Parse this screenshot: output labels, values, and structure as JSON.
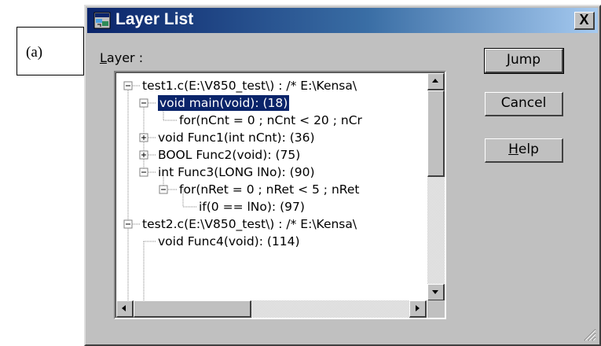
{
  "annotation": {
    "label": "(a)"
  },
  "dialog": {
    "title": "Layer List",
    "close_label": "X",
    "layer_label_prefix": "L",
    "layer_label_rest": "ayer :"
  },
  "tree": {
    "items": [
      {
        "label": "test1.c(E:\\V850_test\\) : /* E:\\Kensa\\",
        "expander": "minus"
      },
      {
        "label": "void main(void): (18)",
        "expander": "minus",
        "selected": true
      },
      {
        "label": "for(nCnt = 0 ; nCnt < 20 ; nCr",
        "expander": "none"
      },
      {
        "label": "void Func1(int nCnt): (36)",
        "expander": "plus"
      },
      {
        "label": "BOOL Func2(void): (75)",
        "expander": "plus"
      },
      {
        "label": "int Func3(LONG lNo): (90)",
        "expander": "minus"
      },
      {
        "label": "for(nRet = 0 ; nRet < 5 ; nRet",
        "expander": "minus"
      },
      {
        "label": "if(0 == lNo): (97)",
        "expander": "none"
      },
      {
        "label": "test2.c(E:\\V850_test\\) : /* E:\\Kensa\\",
        "expander": "minus"
      },
      {
        "label": "void Func4(void): (114)",
        "expander": "none"
      }
    ]
  },
  "buttons": {
    "jump": {
      "mnemonic": "J",
      "rest": "ump"
    },
    "cancel": {
      "label": "Cancel"
    },
    "help": {
      "mnemonic": "H",
      "rest": "elp"
    }
  },
  "icons": {
    "scroll_up": "scroll-up-arrow-icon",
    "scroll_down": "scroll-down-arrow-icon",
    "scroll_left": "scroll-left-arrow-icon",
    "scroll_right": "scroll-right-arrow-icon",
    "resize_grip": "resize-grip-icon"
  },
  "colors": {
    "selection": "#0a246a",
    "title_start": "#0a246a",
    "title_end": "#a6caf0",
    "face": "#c0c0c0"
  }
}
